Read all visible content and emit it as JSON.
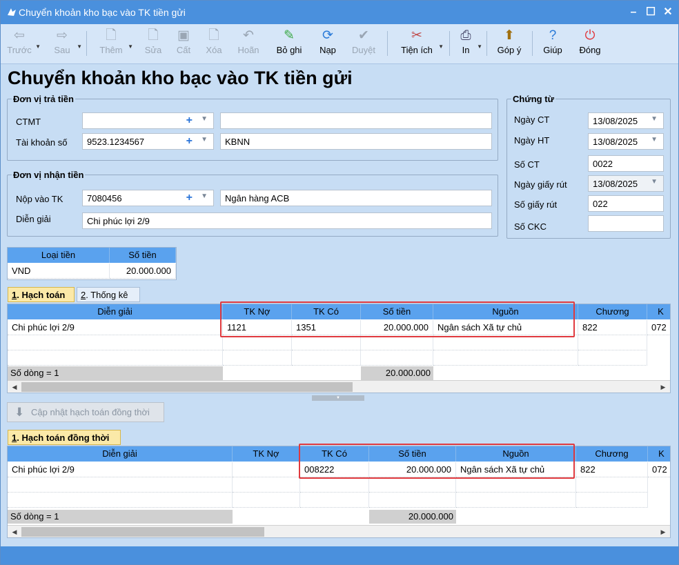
{
  "window": {
    "title": "Chuyển khoản kho bạc vào TK tiền gửi"
  },
  "toolbar": {
    "items": [
      {
        "label": "Trước",
        "icon": "arrow-left-icon"
      },
      {
        "label": "Sau",
        "icon": "arrow-right-icon"
      },
      {
        "label": "Thêm",
        "icon": "new-document-icon"
      },
      {
        "label": "Sửa",
        "icon": "edit-document-icon"
      },
      {
        "label": "Cất",
        "icon": "save-icon"
      },
      {
        "label": "Xóa",
        "icon": "delete-document-icon"
      },
      {
        "label": "Hoãn",
        "icon": "undo-icon"
      },
      {
        "label": "Bỏ ghi",
        "icon": "unpost-icon"
      },
      {
        "label": "Nạp",
        "icon": "refresh-icon"
      },
      {
        "label": "Duyệt",
        "icon": "check-icon"
      },
      {
        "label": "Tiện ích",
        "icon": "tools-icon"
      },
      {
        "label": "In",
        "icon": "printer-icon"
      },
      {
        "label": "Góp ý",
        "icon": "feedback-icon"
      },
      {
        "label": "Giúp",
        "icon": "help-icon"
      },
      {
        "label": "Đóng",
        "icon": "power-icon"
      }
    ]
  },
  "heading": "Chuyển khoản kho bạc vào TK tiền gửi",
  "payer": {
    "legend": "Đơn vị trả tiền",
    "ctmt_label": "CTMT",
    "ctmt_value": "",
    "ctmt_name": "",
    "account_label": "Tài khoản số",
    "account_value": "9523.1234567",
    "account_name": "KBNN"
  },
  "payee": {
    "legend": "Đơn vị nhận tiền",
    "account_label": "Nộp vào TK",
    "account_value": "7080456",
    "account_name": "Ngân hàng ACB",
    "desc_label": "Diễn giải",
    "desc_value": "Chi phúc lợi 2/9"
  },
  "voucher": {
    "legend": "Chứng từ",
    "ngay_ct_label": "Ngày CT",
    "ngay_ct": "13/08/2025",
    "ngay_ht_label": "Ngày HT",
    "ngay_ht": "13/08/2025",
    "so_ct_label": "Số CT",
    "so_ct": "0022",
    "ngay_giay_rut_label": "Ngày giấy rút",
    "ngay_giay_rut": "13/08/2025",
    "so_giay_rut_label": "Số giấy rút",
    "so_giay_rut": "022",
    "so_ckc_label": "Số CKC",
    "so_ckc": ""
  },
  "currency": {
    "headers": [
      "Loại tiền",
      "Số tiền"
    ],
    "row": [
      "VND",
      "20.000.000"
    ]
  },
  "tabs1": [
    {
      "number": "1",
      "label": ". Hạch toán"
    },
    {
      "number": "2",
      "label": ". Thống kê"
    }
  ],
  "grid1": {
    "headers": [
      "Diễn giải",
      "TK Nợ",
      "TK Có",
      "Số tiền",
      "Nguồn",
      "Chương",
      "K"
    ],
    "row": [
      "Chi phúc lợi 2/9",
      "1121",
      "1351",
      "20.000.000",
      "Ngân sách Xã tự chủ",
      "822",
      "072"
    ],
    "footer_count": "Số dòng = 1",
    "footer_total": "20.000.000"
  },
  "update_button": "Cập nhật hạch toán đồng thời",
  "tabs2": [
    {
      "number": "1",
      "label": ". Hạch toán đồng thời"
    }
  ],
  "grid2": {
    "headers": [
      "Diễn giải",
      "TK Nợ",
      "TK Có",
      "Số tiền",
      "Nguồn",
      "Chương",
      "K"
    ],
    "row": [
      "Chi phúc lợi 2/9",
      "",
      "008222",
      "20.000.000",
      "Ngân sách Xã tự chủ",
      "822",
      "072"
    ],
    "footer_count": "Số dòng = 1",
    "footer_total": "20.000.000"
  },
  "colors": {
    "titlebar": "#4a90dd",
    "grid_header": "#5aa2ee",
    "active_tab": "#fbe9a8",
    "highlight_box": "#e0393e",
    "window_bg": "#c7ddf4"
  }
}
